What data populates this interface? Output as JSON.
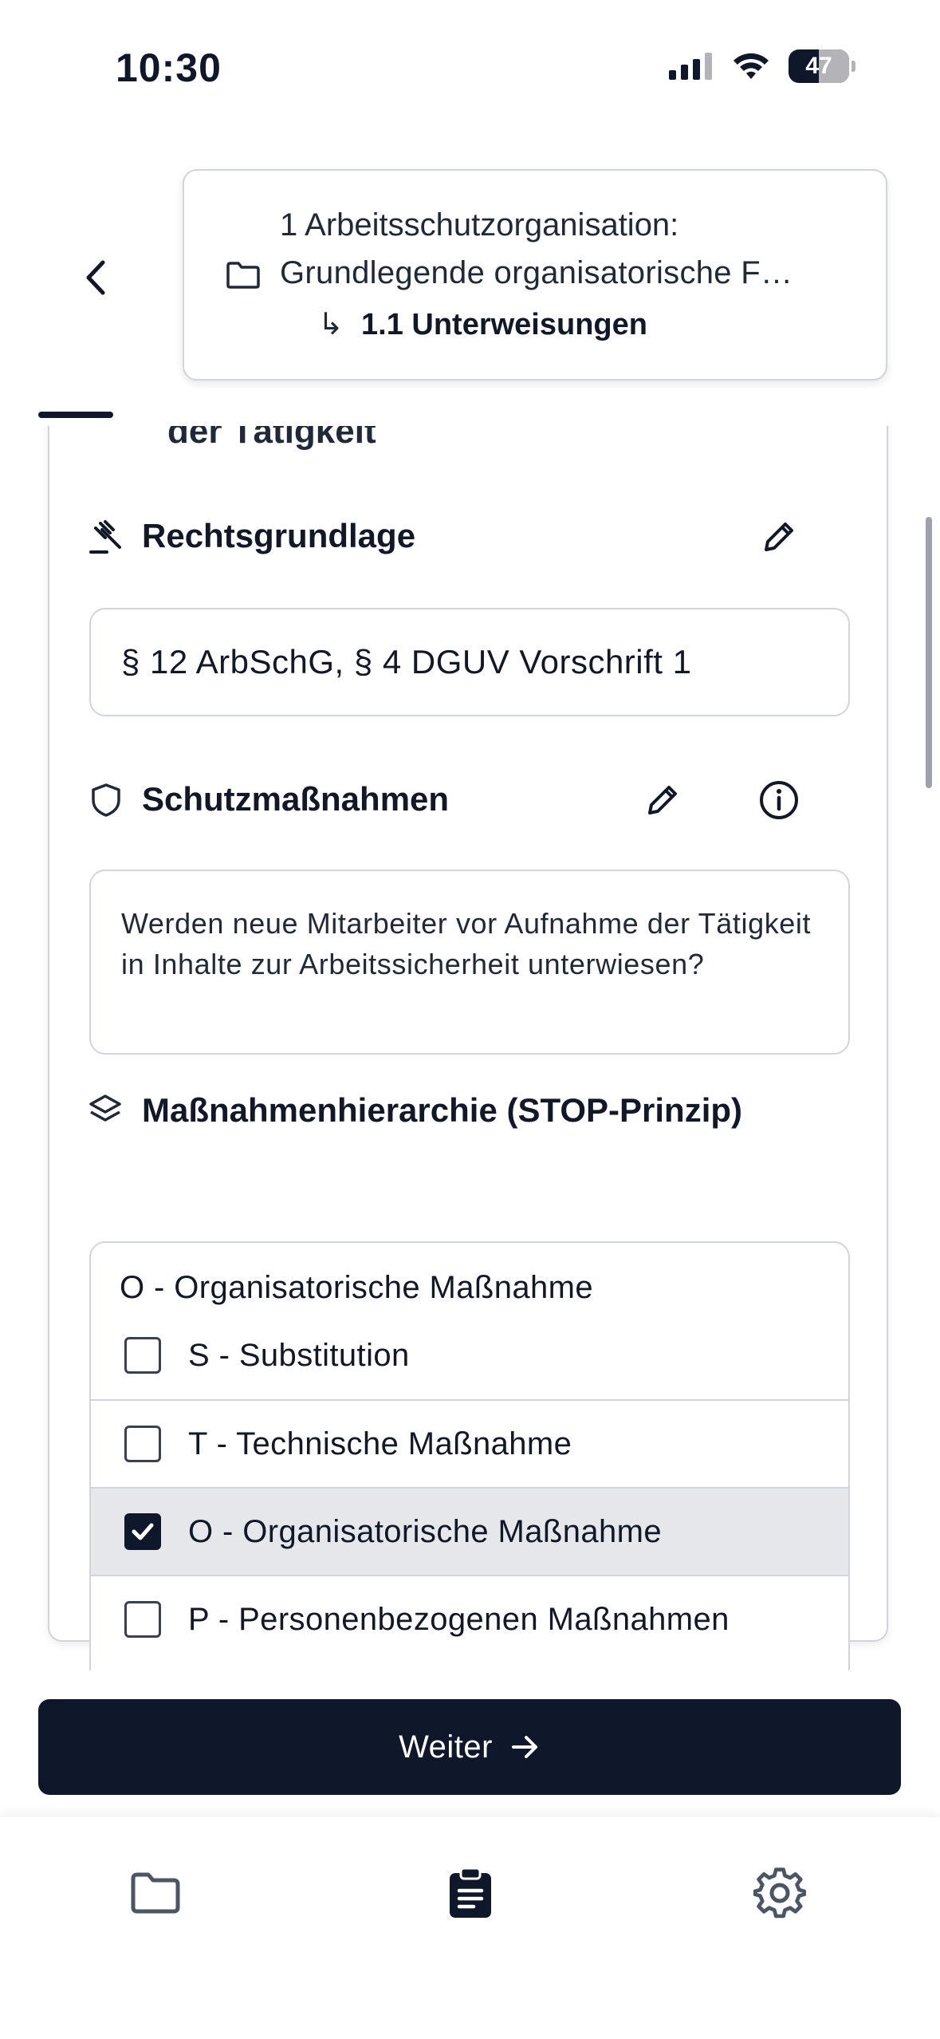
{
  "status_bar": {
    "time": "10:30",
    "battery": "47"
  },
  "breadcrumb": {
    "line1": "1 Arbeitsschutzorganisation:",
    "line2": "Grundlegende organisatorische F…",
    "arrow": "↳",
    "line3": "1.1 Unterweisungen"
  },
  "card": {
    "clipped_title": "der Tätigkeit",
    "rechtsgrundlage": {
      "title": "Rechtsgrundlage",
      "value": "§ 12 ArbSchG, § 4 DGUV Vorschrift 1"
    },
    "schutzmassnahmen": {
      "title": "Schutzmaßnahmen",
      "value": "Werden neue Mitarbeiter vor Aufnahme der Tätigkeit in Inhalte zur Arbeitssicherheit unterwiesen?"
    },
    "hierarchie": {
      "title": "Maßnahmenhierarchie (STOP-Prinzip)",
      "selected_value": "O - Organisatorische Maßnahme",
      "options": [
        {
          "label": "S - Substitution",
          "checked": false
        },
        {
          "label": "T - Technische Maßnahme",
          "checked": false
        },
        {
          "label": "O - Organisatorische Maßnahme",
          "checked": true
        },
        {
          "label": "P - Personenbezogenen Maßnahmen",
          "checked": false
        }
      ]
    }
  },
  "primary_button": {
    "label": "Weiter",
    "icon": "arrow-right-icon"
  },
  "bottom_nav": [
    {
      "name": "folder",
      "icon": "folder-icon",
      "active": false
    },
    {
      "name": "checklist",
      "icon": "clipboard-icon",
      "active": true
    },
    {
      "name": "settings",
      "icon": "gear-icon",
      "active": false
    }
  ],
  "colors": {
    "primary": "#0f172a",
    "border": "#d1d5db",
    "selected_row": "#e5e7eb"
  }
}
